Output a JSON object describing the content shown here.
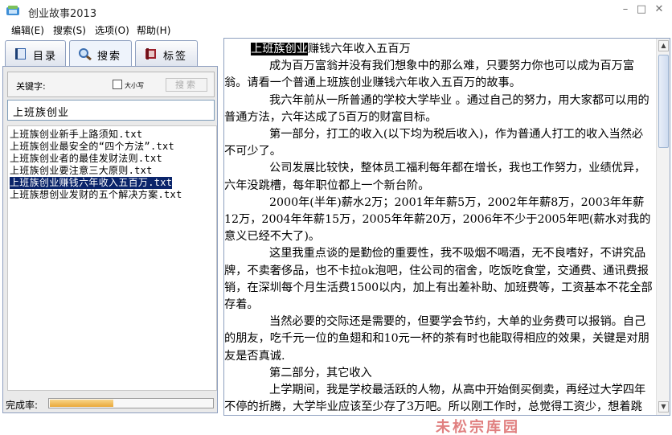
{
  "window": {
    "title": "创业故事2013",
    "controls": {
      "minimize": "–",
      "maximize": "□",
      "close": "✕"
    }
  },
  "menu": [
    {
      "label": "编辑(E)"
    },
    {
      "label": "搜索(S)"
    },
    {
      "label": "选项(O)"
    },
    {
      "label": "帮助(H)"
    }
  ],
  "tabs": [
    {
      "label": "目录",
      "icon": "book-icon"
    },
    {
      "label": "搜索",
      "icon": "magnifier-icon",
      "active": true
    },
    {
      "label": "标签",
      "icon": "bookmark-icon"
    }
  ],
  "search": {
    "keyword_label": "关键字:",
    "case_label": "大小写",
    "case_checked": false,
    "button_label": "搜索",
    "keyword_value": "上班族创业"
  },
  "results": [
    "上班族创业新手上路须知.txt",
    "上班族创业最安全的“四个方法”.txt",
    "上班族创业者的最佳发财法则.txt",
    "上班族创业要注意三大原则.txt",
    "上班族创业赚钱六年收入五百万.txt",
    "上班族想创业发财的五个解决方案.txt"
  ],
  "selected_result_index": 4,
  "progress": {
    "label": "完成率:",
    "fraction": 0.39
  },
  "article": {
    "title_highlight": "上班族创业",
    "title_rest": "赚钱六年收入五百万",
    "paragraphs": [
      "成为百万富翁并没有我们想象中的那么难，只要努力你也可以成为百万富翁。请看一个普通上班族创业赚钱六年收入五百万的故事。",
      "我六年前从一所普通的学校大学毕业 。通过自己的努力，用大家都可以用的普通方法，六年达成了5百万的财富目标。",
      "第一部分，打工的收入(以下均为税后收入)，作为普通人打工的收入当然必不可少了。",
      "公司发展比较快，整体员工福利每年都在增长，我也工作努力，业绩优异，六年没跳槽，每年职位都上一个新台阶。",
      "2000年(半年)薪水2万；2001年年薪5万，2002年年薪8万，2003年年薪12万，2004年年薪15万，2005年年薪20万，2006年不少于2005年吧(薪水对我的意义已经不大了)。",
      "这里我重点谈的是勤俭的重要性，我不吸烟不喝酒，无不良嗜好，不讲究品牌，不卖奢侈品，也不卡拉ok泡吧，住公司的宿舍，吃饭吃食堂，交通费、通讯费报销，在深圳每个月生活费1500以内，加上有出差补助、加班费等，工资基本不花全部存着。",
      "当然必要的交际还是需要的，但要学会节约，大单的业务费可以报销。自己的朋友，吃千元一位的鱼翅和和10元一杯的茶有时也能取得相应的效果，关键是对朋友是否真诚.",
      "第二部分，其它收入",
      "上学期间，我是学校最活跃的人物，从高中开始倒买倒卖，再经过大学四年不停的折腾，大学毕业应该至少存了3万吧。所以刚工作时，总觉得工资少，想着跳槽，但是觉得公司发展和行业前景都不错就忍下来了，现"
    ]
  },
  "watermark": "未松宗库园"
}
